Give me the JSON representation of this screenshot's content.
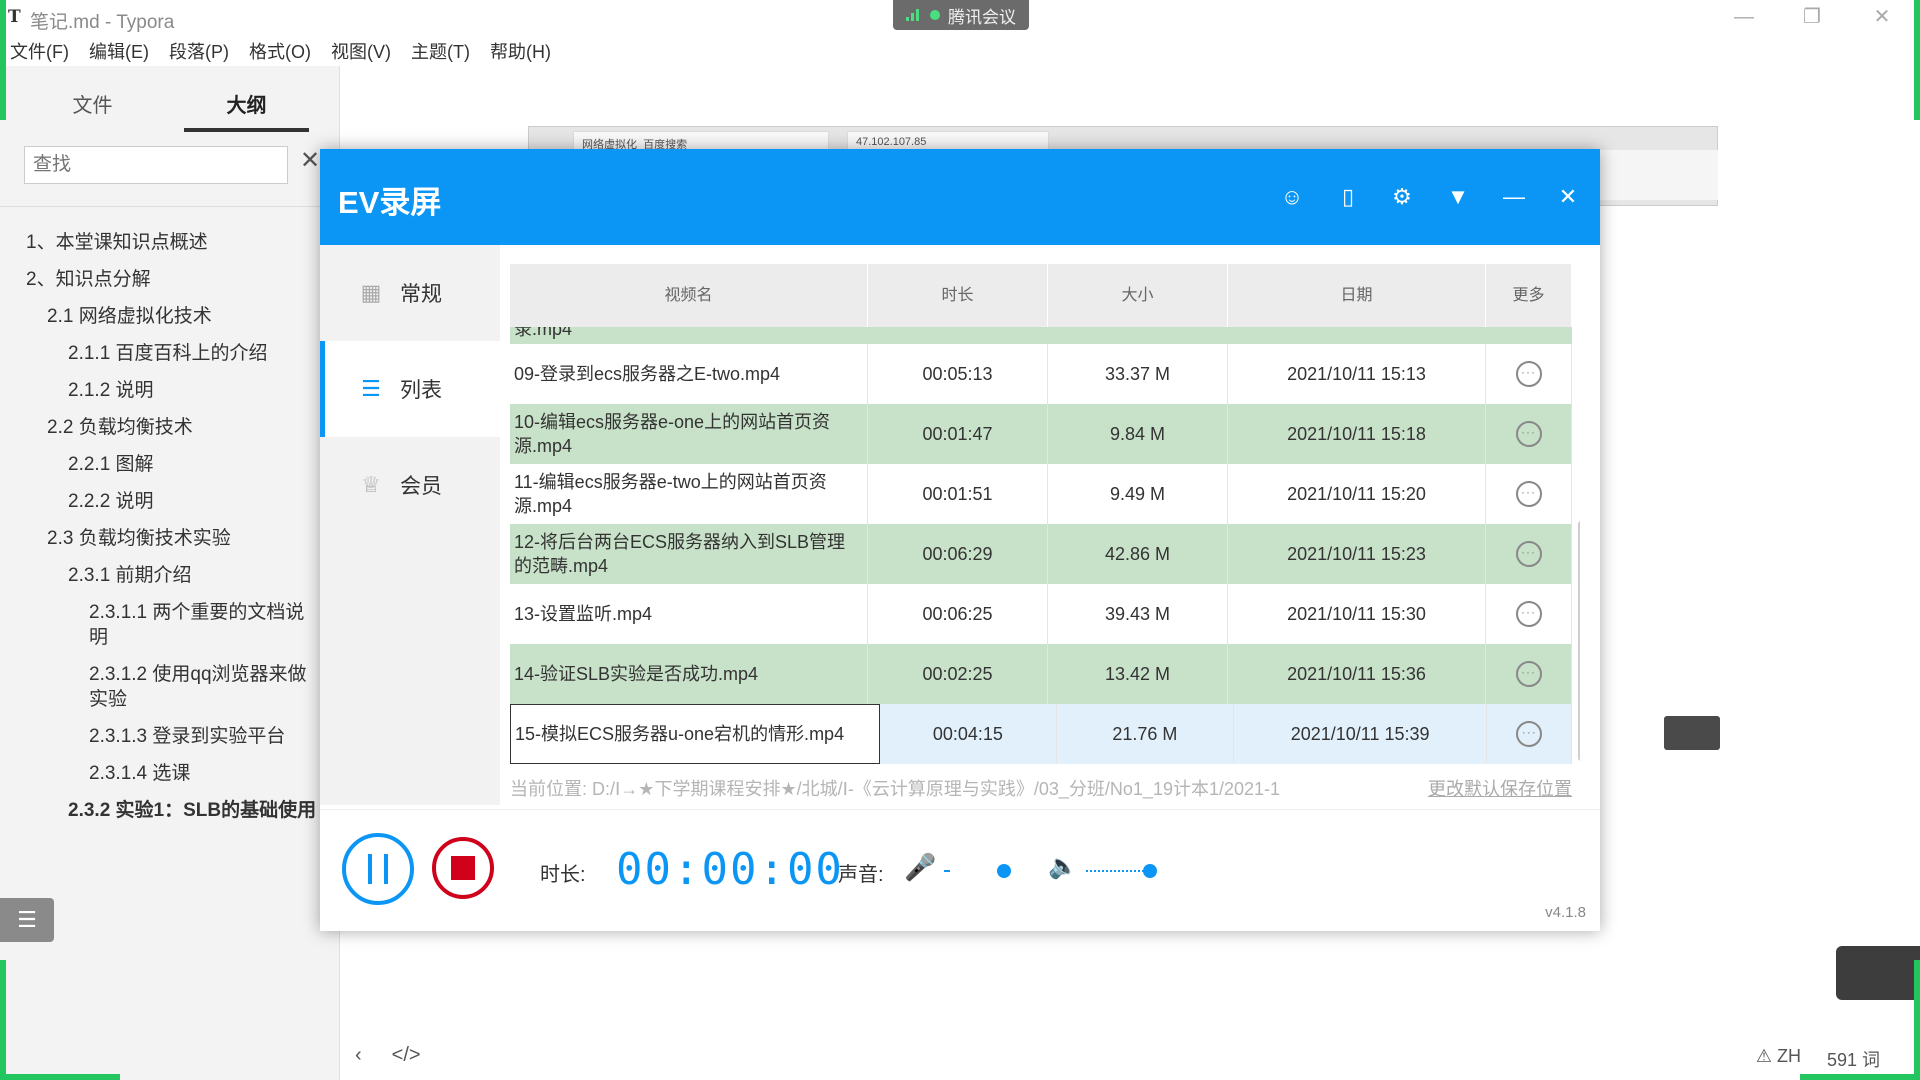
{
  "window": {
    "icon": "T",
    "title": "笔记.md - Typora"
  },
  "meeting": {
    "label": "腾讯会议"
  },
  "menu": [
    "文件(F)",
    "编辑(E)",
    "段落(P)",
    "格式(O)",
    "视图(V)",
    "主题(T)",
    "帮助(H)"
  ],
  "sidebar": {
    "tabs": [
      "文件",
      "大纲"
    ],
    "search_placeholder": "查找",
    "outline": [
      {
        "label": "1、本堂课知识点概述",
        "level": 0
      },
      {
        "label": "2、知识点分解",
        "level": 0
      },
      {
        "label": "2.1 网络虚拟化技术",
        "level": 1
      },
      {
        "label": "2.1.1 百度百科上的介绍",
        "level": 2
      },
      {
        "label": "2.1.2 说明",
        "level": 2
      },
      {
        "label": "2.2 负载均衡技术",
        "level": 1
      },
      {
        "label": "2.2.1 图解",
        "level": 2
      },
      {
        "label": "2.2.2 说明",
        "level": 2
      },
      {
        "label": "2.3 负载均衡技术实验",
        "level": 1
      },
      {
        "label": "2.3.1 前期介绍",
        "level": 2
      },
      {
        "label": "2.3.1.1 两个重要的文档说明",
        "level": 3
      },
      {
        "label": "2.3.1.2 使用qq浏览器来做实验",
        "level": 3
      },
      {
        "label": "2.3.1.3 登录到实验平台",
        "level": 3
      },
      {
        "label": "2.3.1.4 选课",
        "level": 3
      },
      {
        "label": "2.3.2 实验1：SLB的基础使用",
        "level": 2,
        "bold": true
      }
    ]
  },
  "statusbar": {
    "lang": "ZH",
    "words": "591 词"
  },
  "ev": {
    "title": "EV录屏",
    "nav": [
      "常规",
      "列表",
      "会员"
    ],
    "columns": [
      "视频名",
      "时长",
      "大小",
      "日期",
      "更多"
    ],
    "partial_row": "录.mp4",
    "rows": [
      {
        "name": "09-登录到ecs服务器之E-two.mp4",
        "duration": "00:05:13",
        "size": "33.37 M",
        "date": "2021/10/11 15:13"
      },
      {
        "name": "10-编辑ecs服务器e-one上的网站首页资源.mp4",
        "duration": "00:01:47",
        "size": "9.84 M",
        "date": "2021/10/11 15:18"
      },
      {
        "name": "11-编辑ecs服务器e-two上的网站首页资源.mp4",
        "duration": "00:01:51",
        "size": "9.49 M",
        "date": "2021/10/11 15:20"
      },
      {
        "name": "12-将后台两台ECS服务器纳入到SLB管理的范畴.mp4",
        "duration": "00:06:29",
        "size": "42.86 M",
        "date": "2021/10/11 15:23"
      },
      {
        "name": "13-设置监听.mp4",
        "duration": "00:06:25",
        "size": "39.43 M",
        "date": "2021/10/11 15:30"
      },
      {
        "name": "14-验证SLB实验是否成功.mp4",
        "duration": "00:02:25",
        "size": "13.42 M",
        "date": "2021/10/11 15:36"
      },
      {
        "name": "15-模拟ECS服务器u-one宕机的情形.mp4",
        "duration": "00:04:15",
        "size": "21.76 M",
        "date": "2021/10/11 15:39"
      }
    ],
    "path_text": "当前位置: D:/Ⅰ→★下学期课程安排★/北城/Ⅰ-《云计算原理与实践》/03_分班/No1_19计本1/2021-1",
    "change_path": "更改默认保存位置",
    "duration_label": "时长:",
    "duration_value": "00:00:00",
    "volume_label": "声音:",
    "mic_level": 0.1,
    "speaker_level": 1.0,
    "version": "v4.1.8"
  },
  "browser": {
    "tab1": "网络虚拟化_百度搜索",
    "tab2": "47.102.107.85"
  },
  "colors": {
    "ev_blue": "#0b96f5",
    "row_green": "#c8e2c9",
    "selected_row": "#e1f0fb",
    "stop_red": "#d0021b",
    "share_border": "#22c55e"
  }
}
